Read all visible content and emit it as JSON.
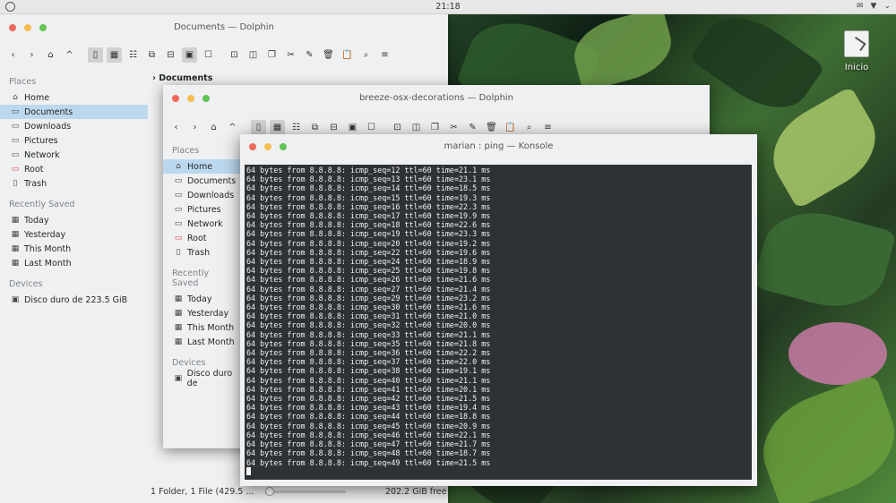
{
  "panel": {
    "clock": "21:18"
  },
  "desktop": {
    "icon_label": "Inicio"
  },
  "dolphin_back": {
    "title": "Documents — Dolphin",
    "breadcrumb": "Documents",
    "status": "1 Folder, 1 File (429.5 ...",
    "free_space": "202.2 GiB free",
    "places_header": "Places",
    "places": [
      {
        "label": "Home",
        "icon": "home-icon",
        "selected": false
      },
      {
        "label": "Documents",
        "icon": "folder-icon",
        "selected": true
      },
      {
        "label": "Downloads",
        "icon": "folder-icon",
        "selected": false
      },
      {
        "label": "Pictures",
        "icon": "folder-icon",
        "selected": false
      },
      {
        "label": "Network",
        "icon": "network-icon",
        "selected": false
      },
      {
        "label": "Root",
        "icon": "folder-red-icon",
        "selected": false
      },
      {
        "label": "Trash",
        "icon": "trash-icon",
        "selected": false
      }
    ],
    "recent_header": "Recently Saved",
    "recent": [
      "Today",
      "Yesterday",
      "This Month",
      "Last Month"
    ],
    "devices_header": "Devices",
    "devices": [
      "Disco duro de 223.5 GiB"
    ]
  },
  "dolphin_mid": {
    "title": "breeze-osx-decorations — Dolphin",
    "places_header": "Places",
    "places": [
      {
        "label": "Home",
        "selected": true
      },
      {
        "label": "Documents",
        "selected": false
      },
      {
        "label": "Downloads",
        "selected": false
      },
      {
        "label": "Pictures",
        "selected": false
      },
      {
        "label": "Network",
        "selected": false
      },
      {
        "label": "Root",
        "selected": false
      },
      {
        "label": "Trash",
        "selected": false
      }
    ],
    "recent_header": "Recently Saved",
    "recent": [
      "Today",
      "Yesterday",
      "This Month",
      "Last Month"
    ],
    "devices_header": "Devices",
    "devices": [
      "Disco duro de"
    ]
  },
  "konsole": {
    "title": "marian : ping — Konsole",
    "lines": [
      "64 bytes from 8.8.8.8: icmp_seq=12 ttl=60 time=21.1 ms",
      "64 bytes from 8.8.8.8: icmp_seq=13 ttl=60 time=23.1 ms",
      "64 bytes from 8.8.8.8: icmp_seq=14 ttl=60 time=18.5 ms",
      "64 bytes from 8.8.8.8: icmp_seq=15 ttl=60 time=19.3 ms",
      "64 bytes from 8.8.8.8: icmp_seq=16 ttl=60 time=22.3 ms",
      "64 bytes from 8.8.8.8: icmp_seq=17 ttl=60 time=19.9 ms",
      "64 bytes from 8.8.8.8: icmp_seq=18 ttl=60 time=22.6 ms",
      "64 bytes from 8.8.8.8: icmp_seq=19 ttl=60 time=23.3 ms",
      "64 bytes from 8.8.8.8: icmp_seq=20 ttl=60 time=19.2 ms",
      "64 bytes from 8.8.8.8: icmp_seq=22 ttl=60 time=19.6 ms",
      "64 bytes from 8.8.8.8: icmp_seq=24 ttl=60 time=18.9 ms",
      "64 bytes from 8.8.8.8: icmp_seq=25 ttl=60 time=19.8 ms",
      "64 bytes from 8.8.8.8: icmp_seq=26 ttl=60 time=21.6 ms",
      "64 bytes from 8.8.8.8: icmp_seq=27 ttl=60 time=21.4 ms",
      "64 bytes from 8.8.8.8: icmp_seq=29 ttl=60 time=23.2 ms",
      "64 bytes from 8.8.8.8: icmp_seq=30 ttl=60 time=21.6 ms",
      "64 bytes from 8.8.8.8: icmp_seq=31 ttl=60 time=21.0 ms",
      "64 bytes from 8.8.8.8: icmp_seq=32 ttl=60 time=20.0 ms",
      "64 bytes from 8.8.8.8: icmp_seq=33 ttl=60 time=21.1 ms",
      "64 bytes from 8.8.8.8: icmp_seq=35 ttl=60 time=21.8 ms",
      "64 bytes from 8.8.8.8: icmp_seq=36 ttl=60 time=22.2 ms",
      "64 bytes from 8.8.8.8: icmp_seq=37 ttl=60 time=22.0 ms",
      "64 bytes from 8.8.8.8: icmp_seq=38 ttl=60 time=19.1 ms",
      "64 bytes from 8.8.8.8: icmp_seq=40 ttl=60 time=21.1 ms",
      "64 bytes from 8.8.8.8: icmp_seq=41 ttl=60 time=20.1 ms",
      "64 bytes from 8.8.8.8: icmp_seq=42 ttl=60 time=21.5 ms",
      "64 bytes from 8.8.8.8: icmp_seq=43 ttl=60 time=19.4 ms",
      "64 bytes from 8.8.8.8: icmp_seq=44 ttl=60 time=18.8 ms",
      "64 bytes from 8.8.8.8: icmp_seq=45 ttl=60 time=20.9 ms",
      "64 bytes from 8.8.8.8: icmp_seq=46 ttl=60 time=22.1 ms",
      "64 bytes from 8.8.8.8: icmp_seq=47 ttl=60 time=21.7 ms",
      "64 bytes from 8.8.8.8: icmp_seq=48 ttl=60 time=18.7 ms",
      "64 bytes from 8.8.8.8: icmp_seq=49 ttl=60 time=21.5 ms"
    ]
  },
  "colors": {
    "selection": "#bcd8ee",
    "terminal_bg": "#2e3235",
    "close": "#ed6a5e",
    "minimize": "#f4be4f",
    "maximize": "#61c454"
  }
}
